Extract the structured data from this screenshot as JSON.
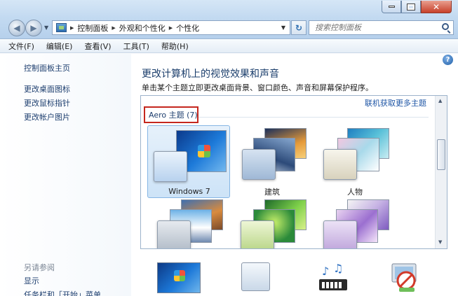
{
  "window": {
    "controls": {
      "minimize": "",
      "maximize": "",
      "close": "✕"
    }
  },
  "nav": {
    "back_glyph": "◀",
    "forward_glyph": "▶",
    "breadcrumbs": [
      "控制面板",
      "外观和个性化",
      "个性化"
    ],
    "refresh_glyph": "↻",
    "search_placeholder": "搜索控制面板"
  },
  "menu": [
    "文件(F)",
    "编辑(E)",
    "查看(V)",
    "工具(T)",
    "帮助(H)"
  ],
  "sidebar": {
    "home_link": "控制面板主页",
    "links": [
      "更改桌面图标",
      "更改鼠标指针",
      "更改帐户图片"
    ],
    "see_also_title": "另请参阅",
    "see_also_links": [
      "显示",
      "任务栏和「开始」菜单"
    ]
  },
  "main": {
    "help_glyph": "?",
    "title": "更改计算机上的视觉效果和声音",
    "description": "单击某个主题立即更改桌面背景、窗口颜色、声音和屏幕保护程序。",
    "more_themes_link": "联机获取更多主题",
    "group_header": "Aero 主题 (7)",
    "themes": [
      {
        "label": "Windows 7",
        "selected": true
      },
      {
        "label": "建筑",
        "selected": false
      },
      {
        "label": "人物",
        "selected": false
      },
      {
        "label": "",
        "selected": false
      },
      {
        "label": "",
        "selected": false
      },
      {
        "label": "",
        "selected": false
      }
    ]
  },
  "bottom_icons": [
    "wallpaper-icon",
    "window-color-icon",
    "sounds-icon",
    "screensaver-icon"
  ],
  "colors": {
    "title_blue": "#1a3d6b",
    "link_blue": "#1e55a5",
    "highlight_red": "#c5271e",
    "selection_blue": "#cde3f7"
  }
}
